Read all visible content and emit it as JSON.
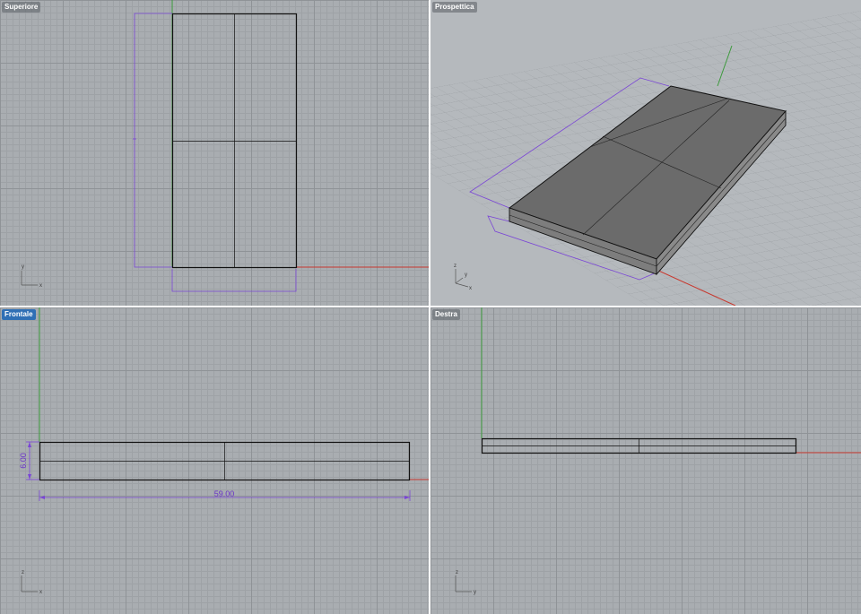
{
  "viewports": {
    "top": {
      "title": "Superiore",
      "active": false
    },
    "perspective": {
      "title": "Prospettica",
      "active": false
    },
    "front": {
      "title": "Frontale",
      "active": true
    },
    "right": {
      "title": "Destra",
      "active": false
    }
  },
  "dimensions": {
    "front_width": "59.00",
    "front_height": "6.00"
  },
  "axis_labels": {
    "x": "x",
    "y": "y",
    "z": "z"
  },
  "colors": {
    "x_axis": "#c8382e",
    "y_axis": "#3c9a3c",
    "dimension": "#7a45d6",
    "active_tab": "#2f6fb5",
    "grid_bg": "#a9adb1"
  }
}
